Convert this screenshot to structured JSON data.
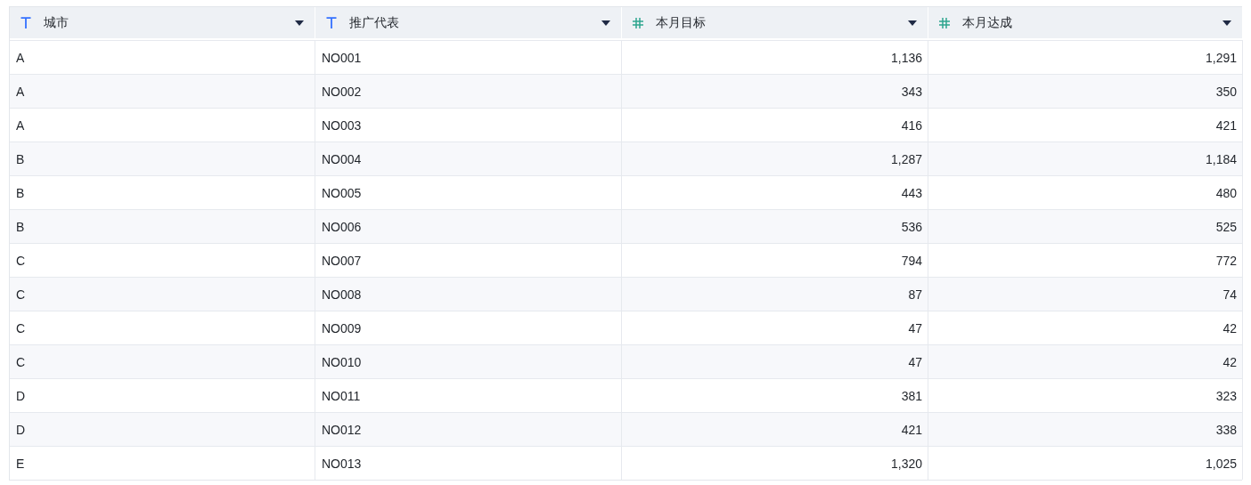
{
  "table": {
    "columns": [
      {
        "label": "城市",
        "kind": "text"
      },
      {
        "label": "推广代表",
        "kind": "text"
      },
      {
        "label": "本月目标",
        "kind": "number"
      },
      {
        "label": "本月达成",
        "kind": "number"
      }
    ],
    "rows": [
      [
        "A",
        "NO001",
        "1,136",
        "1,291"
      ],
      [
        "A",
        "NO002",
        "343",
        "350"
      ],
      [
        "A",
        "NO003",
        "416",
        "421"
      ],
      [
        "B",
        "NO004",
        "1,287",
        "1,184"
      ],
      [
        "B",
        "NO005",
        "443",
        "480"
      ],
      [
        "B",
        "NO006",
        "536",
        "525"
      ],
      [
        "C",
        "NO007",
        "794",
        "772"
      ],
      [
        "C",
        "NO008",
        "87",
        "74"
      ],
      [
        "C",
        "NO009",
        "47",
        "42"
      ],
      [
        "C",
        "NO010",
        "47",
        "42"
      ],
      [
        "D",
        "NO011",
        "381",
        "323"
      ],
      [
        "D",
        "NO012",
        "421",
        "338"
      ],
      [
        "E",
        "NO013",
        "1,320",
        "1,025"
      ]
    ]
  }
}
